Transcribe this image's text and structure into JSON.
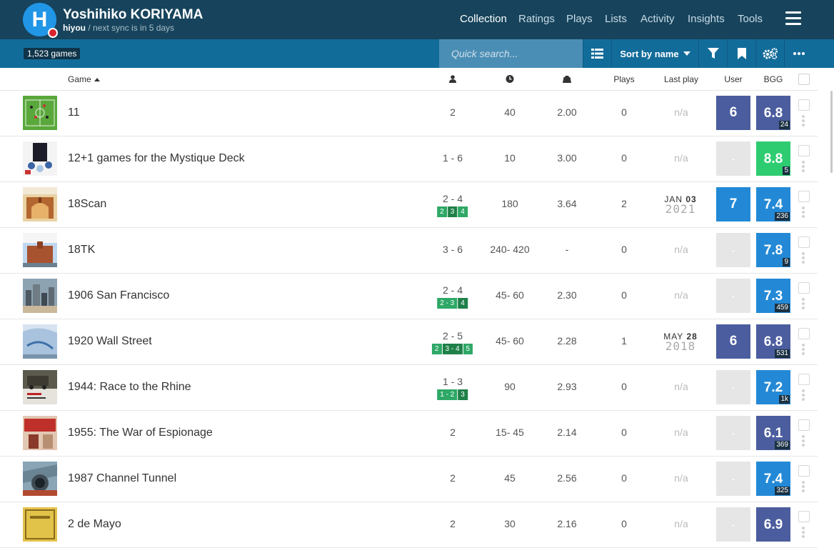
{
  "user": {
    "initial": "H",
    "name": "Yoshihiko KORIYAMA",
    "username": "hiyou",
    "sync_text": " / next sync is in 5 days"
  },
  "nav": {
    "items": [
      {
        "label": "Collection",
        "active": true
      },
      {
        "label": "Ratings",
        "active": false
      },
      {
        "label": "Plays",
        "active": false
      },
      {
        "label": "Lists",
        "active": false
      },
      {
        "label": "Activity",
        "active": false
      },
      {
        "label": "Insights",
        "active": false
      },
      {
        "label": "Tools",
        "active": false
      }
    ]
  },
  "toolbar": {
    "count": "1,523 games",
    "search_placeholder": "Quick search...",
    "sort_label": "Sort by name"
  },
  "columns": {
    "game": "Game",
    "plays": "Plays",
    "last_play": "Last play",
    "user": "User",
    "bgg": "BGG"
  },
  "colors": {
    "header_bg": "#17445c",
    "toolbar_bg": "#126c9a",
    "search_bg": "#4b8eb5",
    "rating_6": "#4b5d9e",
    "rating_7": "#2389d6",
    "rating_8": "#2ecc71",
    "empty": "#e6e6e6"
  },
  "games": [
    {
      "name": "11",
      "players": "2",
      "best": [],
      "time": "40",
      "weight": "2.00",
      "plays": "0",
      "last_play": null,
      "user": "6",
      "user_color": "#4b5d9e",
      "bgg": "6.8",
      "bgg_color": "#4b5d9e",
      "votes": "24",
      "thumb": "field"
    },
    {
      "name": "12+1 games for the Mystique Deck",
      "players": "1 - 6",
      "best": [],
      "time": "10",
      "weight": "3.00",
      "plays": "0",
      "last_play": null,
      "user": "-",
      "user_color": null,
      "bgg": "8.8",
      "bgg_color": "#2ecc71",
      "votes": "5",
      "thumb": "cards"
    },
    {
      "name": "18Scan",
      "players": "2 - 4",
      "best": [
        {
          "t": "2",
          "c": "rec"
        },
        {
          "t": "3",
          "c": "top"
        },
        {
          "t": "4",
          "c": "rec"
        }
      ],
      "time": "180",
      "weight": "3.64",
      "plays": "2",
      "last_play": {
        "md_month": "JAN",
        "md_day": "03",
        "year": "2021"
      },
      "user": "7",
      "user_color": "#2389d6",
      "bgg": "7.4",
      "bgg_color": "#2389d6",
      "votes": "236",
      "thumb": "station"
    },
    {
      "name": "18TK",
      "players": "3 - 6",
      "best": [],
      "time": "240- 420",
      "weight": "-",
      "plays": "0",
      "last_play": null,
      "user": "-",
      "user_color": null,
      "bgg": "7.8",
      "bgg_color": "#2389d6",
      "votes": "9",
      "thumb": "tokyo"
    },
    {
      "name": "1906 San Francisco",
      "players": "2 - 4",
      "best": [
        {
          "t": "2 - 3",
          "c": "rec"
        },
        {
          "t": "4",
          "c": "top"
        }
      ],
      "time": "45- 60",
      "weight": "2.30",
      "plays": "0",
      "last_play": null,
      "user": "-",
      "user_color": null,
      "bgg": "7.3",
      "bgg_color": "#2389d6",
      "votes": "459",
      "thumb": "city"
    },
    {
      "name": "1920 Wall Street",
      "players": "2 - 5",
      "best": [
        {
          "t": "2",
          "c": "rec"
        },
        {
          "t": "3 - 4",
          "c": "top"
        },
        {
          "t": "5",
          "c": "rec"
        }
      ],
      "time": "45- 60",
      "weight": "2.28",
      "plays": "1",
      "last_play": {
        "md_month": "MAY",
        "md_day": "28",
        "year": "2018"
      },
      "user": "6",
      "user_color": "#4b5d9e",
      "bgg": "6.8",
      "bgg_color": "#4b5d9e",
      "votes": "531",
      "thumb": "wall"
    },
    {
      "name": "1944: Race to the Rhine",
      "players": "1 - 3",
      "best": [
        {
          "t": "1 - 2",
          "c": "rec"
        },
        {
          "t": "3",
          "c": "top"
        }
      ],
      "time": "90",
      "weight": "2.93",
      "plays": "0",
      "last_play": null,
      "user": "-",
      "user_color": null,
      "bgg": "7.2",
      "bgg_color": "#2389d6",
      "votes": "1k",
      "thumb": "truck"
    },
    {
      "name": "1955: The War of Espionage",
      "players": "2",
      "best": [],
      "time": "15- 45",
      "weight": "2.14",
      "plays": "0",
      "last_play": null,
      "user": "-",
      "user_color": null,
      "bgg": "6.1",
      "bgg_color": "#4b5d9e",
      "votes": "369",
      "thumb": "spy"
    },
    {
      "name": "1987 Channel Tunnel",
      "players": "2",
      "best": [],
      "time": "45",
      "weight": "2.56",
      "plays": "0",
      "last_play": null,
      "user": "-",
      "user_color": null,
      "bgg": "7.4",
      "bgg_color": "#2389d6",
      "votes": "325",
      "thumb": "tunnel"
    },
    {
      "name": "2 de Mayo",
      "players": "2",
      "best": [],
      "time": "30",
      "weight": "2.16",
      "plays": "0",
      "last_play": null,
      "user": "-",
      "user_color": null,
      "bgg": "6.9",
      "bgg_color": "#4b5d9e",
      "votes": "",
      "thumb": "mayo"
    }
  ]
}
